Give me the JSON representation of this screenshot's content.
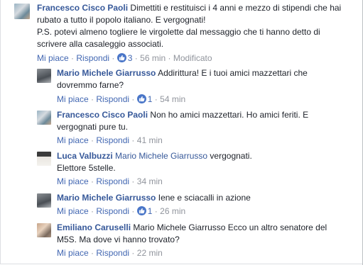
{
  "comments": [
    {
      "author": "Francesco Cisco Paoli",
      "lines": [
        "Dimettiti e restituisci i 4 anni e mezzo di stipendi che hai",
        "rubato a tutto il popolo italiano. E vergognati!",
        "P.S. potevi almeno togliere le virgolette dal messaggio che ti hanno detto di",
        "scrivere alla casaleggio associati."
      ],
      "like": "Mi piace",
      "reply": "Rispondi",
      "reactions": "3",
      "time": "56 min",
      "edited": "Modificato"
    },
    {
      "author": "Mario Michele Giarrusso",
      "lines": [
        "Addirittura! E i tuoi amici mazzettari che",
        "dovremmo farne?"
      ],
      "like": "Mi piace",
      "reply": "Rispondi",
      "reactions": "1",
      "time": "54 min"
    },
    {
      "author": "Francesco Cisco Paoli",
      "lines": [
        "Non ho amici mazzettari. Ho amici feriti. E",
        "vergognati pure tu."
      ],
      "like": "Mi piace",
      "reply": "Rispondi",
      "time": "41 min"
    },
    {
      "author": "Luca Valbuzzi",
      "mention": "Mario Michele Giarrusso",
      "lines": [
        "vergognati.",
        "Elettore 5stelle."
      ],
      "like": "Mi piace",
      "reply": "Rispondi",
      "time": "34 min"
    },
    {
      "author": "Mario Michele Giarrusso",
      "lines": [
        "Iene e sciacalli in azione"
      ],
      "like": "Mi piace",
      "reply": "Rispondi",
      "reactions": "1",
      "time": "26 min"
    },
    {
      "author": "Emiliano Caruselli",
      "lines": [
        "Mario Michele Giarrusso Ecco un altro senatore del",
        "M5S. Ma dove vi hanno trovato?"
      ],
      "like": "Mi piace",
      "reply": "Rispondi",
      "time": "22 min"
    }
  ],
  "colors": {
    "name": "#365899",
    "link": "#4267b2",
    "meta": "#90949c",
    "text": "#1d2129",
    "like_badge": "#4a76c8"
  }
}
